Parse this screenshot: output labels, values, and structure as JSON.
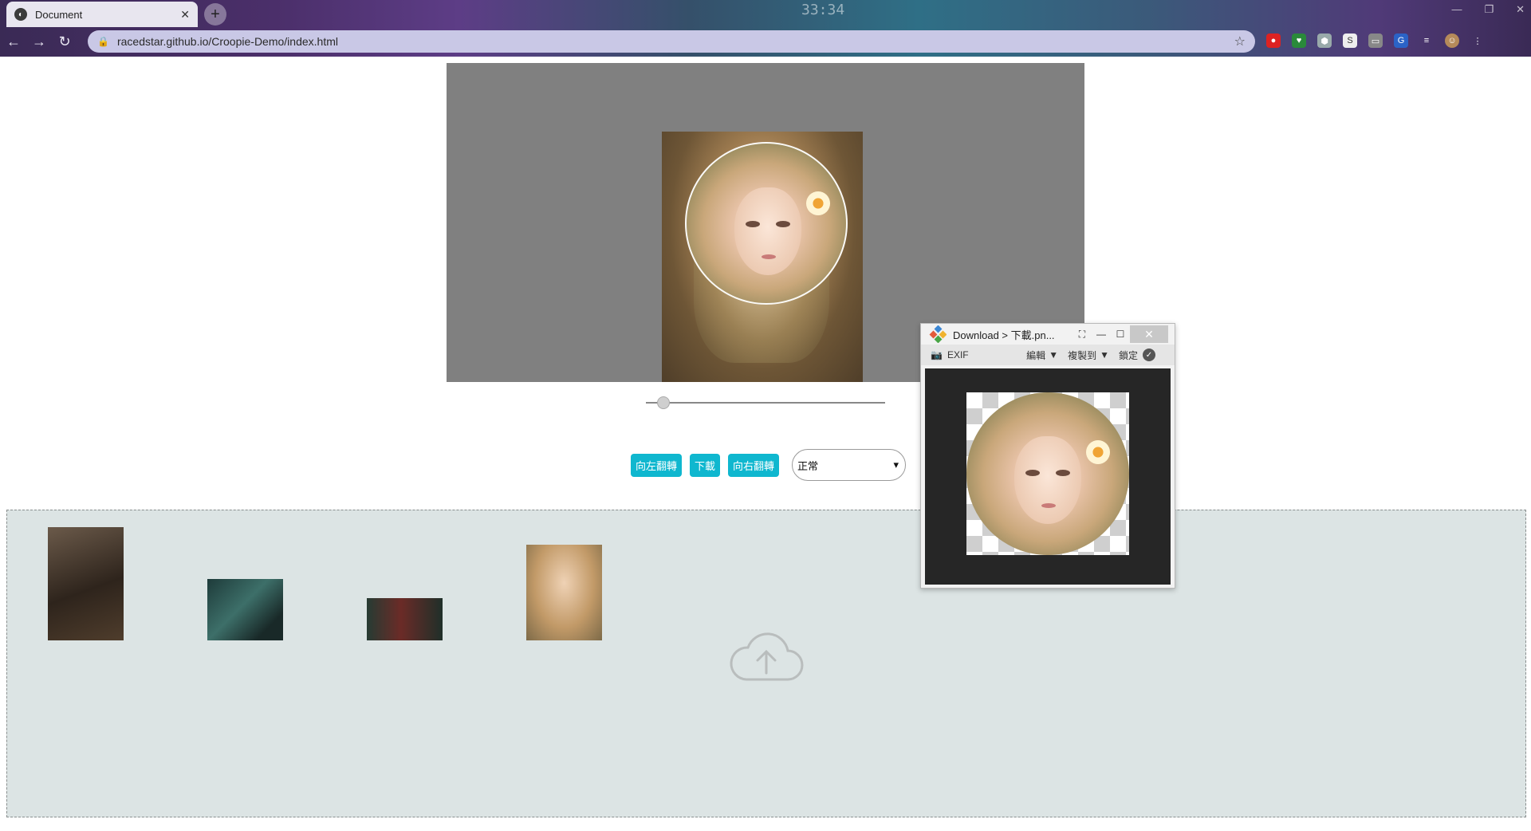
{
  "browser": {
    "tab_title": "Document",
    "tab_close": "✕",
    "new_tab": "+",
    "url": "racedstar.github.io/Croopie-Demo/index.html",
    "clock": "33:34",
    "extensions": [
      "record-icon",
      "heart-icon",
      "shield-icon",
      "s-icon",
      "ticket-icon",
      "translate-icon",
      "playlist-icon",
      "avatar-icon"
    ]
  },
  "controls": {
    "rotate_left": "向左翻轉",
    "download": "下載",
    "rotate_right": "向右翻轉",
    "mode_value": "正常",
    "mode_caret": "▾"
  },
  "zoom": {
    "value": 0.05
  },
  "viewer": {
    "title": "Download > 下載.pn...",
    "exif": "EXIF",
    "edit": "編輯",
    "copy_to": "複製到",
    "lock": "鎖定",
    "close": "✕"
  },
  "dropzone": {
    "thumbnails": [
      "thumb-1",
      "thumb-2",
      "thumb-3",
      "thumb-4"
    ]
  }
}
